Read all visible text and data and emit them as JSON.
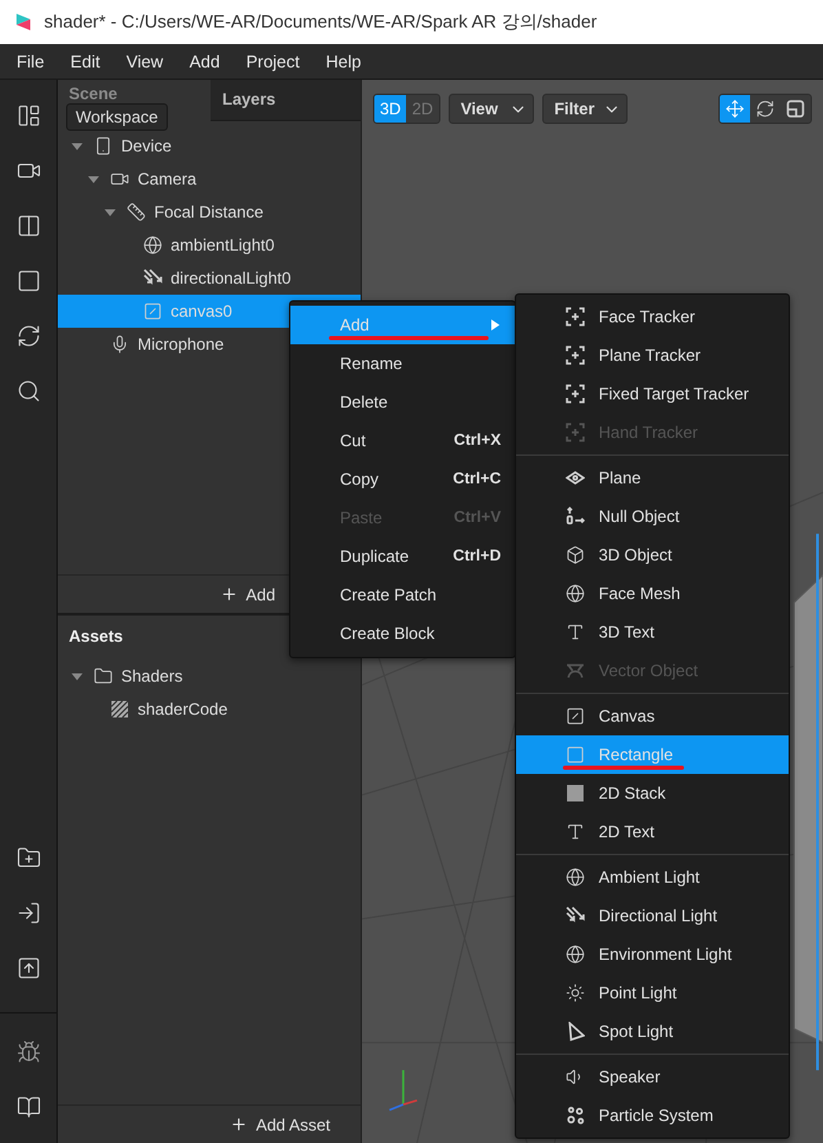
{
  "window": {
    "title": "shader* - C:/Users/WE-AR/Documents/WE-AR/Spark AR 강의/shader"
  },
  "menu_bar": [
    "File",
    "Edit",
    "View",
    "Add",
    "Project",
    "Help"
  ],
  "scene_panel": {
    "tabs": [
      {
        "label": "Scene",
        "selected": true
      },
      {
        "label": "Layers",
        "selected": false
      }
    ],
    "tooltip": "Workspace",
    "tree": [
      {
        "label": "Device",
        "kind": "device",
        "selected": false,
        "expanded": true,
        "children": [
          {
            "label": "Camera",
            "kind": "camera",
            "selected": false,
            "expanded": true,
            "children": [
              {
                "label": "Focal Distance",
                "kind": "ruler",
                "selected": false,
                "expanded": true,
                "children": [
                  {
                    "label": "ambientLight0",
                    "kind": "globe",
                    "selected": false
                  },
                  {
                    "label": "directionalLight0",
                    "kind": "directional",
                    "selected": false
                  },
                  {
                    "label": "canvas0",
                    "kind": "canvas",
                    "selected": true
                  }
                ]
              }
            ]
          },
          {
            "label": "Microphone",
            "kind": "mic",
            "selected": false
          }
        ]
      }
    ],
    "add_button": "Add"
  },
  "assets": {
    "title": "Assets",
    "tree": [
      {
        "label": "Shaders",
        "kind": "folder",
        "selected": false,
        "expanded": true,
        "children": [
          {
            "label": "shaderCode",
            "kind": "shader",
            "selected": false
          }
        ]
      }
    ],
    "add_button": "Add Asset"
  },
  "viewport": {
    "modes": [
      {
        "label": "3D",
        "selected": true
      },
      {
        "label": "2D",
        "selected": false
      }
    ],
    "dropdowns": [
      "View",
      "Filter"
    ],
    "tools": [
      {
        "kind": "move",
        "selected": true
      },
      {
        "kind": "rotate",
        "selected": false
      },
      {
        "kind": "scale",
        "selected": false
      }
    ]
  },
  "context_menu": {
    "items": [
      {
        "label": "Add",
        "selected": true,
        "disabled": false,
        "has_submenu": true,
        "underlined": true
      },
      {
        "label": "Rename",
        "selected": false,
        "disabled": false,
        "has_submenu": false,
        "underlined": false
      },
      {
        "label": "Delete",
        "selected": false,
        "disabled": false,
        "has_submenu": false,
        "underlined": false
      },
      {
        "label": "Cut",
        "shortcut": "Ctrl+X",
        "selected": false,
        "disabled": false,
        "has_submenu": false,
        "underlined": false
      },
      {
        "label": "Copy",
        "shortcut": "Ctrl+C",
        "selected": false,
        "disabled": false,
        "has_submenu": false,
        "underlined": false
      },
      {
        "label": "Paste",
        "shortcut": "Ctrl+V",
        "selected": false,
        "disabled": true,
        "has_submenu": false,
        "underlined": false
      },
      {
        "label": "Duplicate",
        "shortcut": "Ctrl+D",
        "selected": false,
        "disabled": false,
        "has_submenu": false,
        "underlined": false
      },
      {
        "label": "Create Patch",
        "selected": false,
        "disabled": false,
        "has_submenu": false,
        "underlined": false
      },
      {
        "label": "Create Block",
        "selected": false,
        "disabled": false,
        "has_submenu": false,
        "underlined": false
      }
    ]
  },
  "add_submenu": {
    "groups": [
      [
        {
          "label": "Face Tracker",
          "kind": "tracker",
          "selected": false,
          "disabled": false,
          "underlined": false
        },
        {
          "label": "Plane Tracker",
          "kind": "tracker",
          "selected": false,
          "disabled": false,
          "underlined": false
        },
        {
          "label": "Fixed Target Tracker",
          "kind": "tracker",
          "selected": false,
          "disabled": false,
          "underlined": false
        },
        {
          "label": "Hand Tracker",
          "kind": "tracker",
          "selected": false,
          "disabled": true,
          "underlined": false
        }
      ],
      [
        {
          "label": "Plane",
          "kind": "plane",
          "selected": false,
          "disabled": false,
          "underlined": false
        },
        {
          "label": "Null Object",
          "kind": "null",
          "selected": false,
          "disabled": false,
          "underlined": false
        },
        {
          "label": "3D Object",
          "kind": "cube",
          "selected": false,
          "disabled": false,
          "underlined": false
        },
        {
          "label": "Face Mesh",
          "kind": "mesh",
          "selected": false,
          "disabled": false,
          "underlined": false
        },
        {
          "label": "3D Text",
          "kind": "text",
          "selected": false,
          "disabled": false,
          "underlined": false
        },
        {
          "label": "Vector Object",
          "kind": "vector",
          "selected": false,
          "disabled": true,
          "underlined": false
        }
      ],
      [
        {
          "label": "Canvas",
          "kind": "canvas",
          "selected": false,
          "disabled": false,
          "underlined": false
        },
        {
          "label": "Rectangle",
          "kind": "rectangle",
          "selected": true,
          "disabled": false,
          "underlined": true
        },
        {
          "label": "2D Stack",
          "kind": "stack",
          "selected": false,
          "disabled": false,
          "underlined": false
        },
        {
          "label": "2D Text",
          "kind": "text",
          "selected": false,
          "disabled": false,
          "underlined": false
        }
      ],
      [
        {
          "label": "Ambient Light",
          "kind": "globe",
          "selected": false,
          "disabled": false,
          "underlined": false
        },
        {
          "label": "Directional Light",
          "kind": "directional",
          "selected": false,
          "disabled": false,
          "underlined": false
        },
        {
          "label": "Environment Light",
          "kind": "globe",
          "selected": false,
          "disabled": false,
          "underlined": false
        },
        {
          "label": "Point Light",
          "kind": "point",
          "selected": false,
          "disabled": false,
          "underlined": false
        },
        {
          "label": "Spot Light",
          "kind": "spot",
          "selected": false,
          "disabled": false,
          "underlined": false
        }
      ],
      [
        {
          "label": "Speaker",
          "kind": "speaker",
          "selected": false,
          "disabled": false,
          "underlined": false
        },
        {
          "label": "Particle System",
          "kind": "particles",
          "selected": false,
          "disabled": false,
          "underlined": false
        }
      ]
    ]
  }
}
